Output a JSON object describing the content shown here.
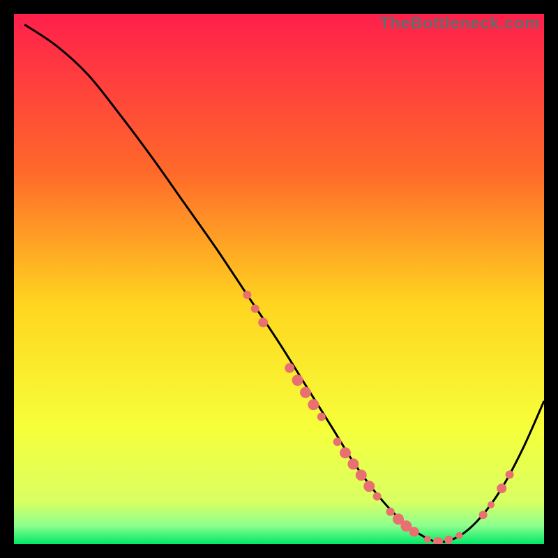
{
  "watermark": "TheBottleneck.com",
  "chart_data": {
    "type": "line",
    "title": "",
    "xlabel": "",
    "ylabel": "",
    "xlim": [
      0,
      100
    ],
    "ylim": [
      0,
      100
    ],
    "grid": false,
    "legend": false,
    "gradient_stops": [
      {
        "offset": 0,
        "color": "#ff1f4b"
      },
      {
        "offset": 0.3,
        "color": "#ff6a2a"
      },
      {
        "offset": 0.55,
        "color": "#ffd61f"
      },
      {
        "offset": 0.78,
        "color": "#f6ff3a"
      },
      {
        "offset": 0.92,
        "color": "#d9ff63"
      },
      {
        "offset": 0.965,
        "color": "#8dff8d"
      },
      {
        "offset": 1.0,
        "color": "#00e868"
      }
    ],
    "series": [
      {
        "name": "bottleneck-curve",
        "color": "#000000",
        "x": [
          2,
          8,
          14,
          20,
          26,
          32,
          38,
          44,
          50,
          55,
          60,
          64,
          68,
          72,
          76,
          80,
          84,
          88,
          92,
          96,
          100
        ],
        "y": [
          98,
          94,
          88.5,
          81,
          73,
          64.5,
          56,
          47,
          38,
          30,
          22,
          15.5,
          10,
          5.5,
          2.2,
          0.4,
          1.5,
          5,
          10.5,
          18,
          27
        ]
      }
    ],
    "markers": {
      "name": "highlight-points",
      "color": "#e87070",
      "points": [
        {
          "x": 44,
          "y": 47,
          "r": 6
        },
        {
          "x": 45.5,
          "y": 44.4,
          "r": 6
        },
        {
          "x": 47,
          "y": 41.8,
          "r": 7
        },
        {
          "x": 52,
          "y": 33.2,
          "r": 7
        },
        {
          "x": 53.5,
          "y": 30.9,
          "r": 8
        },
        {
          "x": 55,
          "y": 28.6,
          "r": 8
        },
        {
          "x": 56.5,
          "y": 26.3,
          "r": 8
        },
        {
          "x": 58,
          "y": 24,
          "r": 6
        },
        {
          "x": 61,
          "y": 19.3,
          "r": 6
        },
        {
          "x": 62.5,
          "y": 17.2,
          "r": 8
        },
        {
          "x": 64,
          "y": 15.1,
          "r": 8
        },
        {
          "x": 65.5,
          "y": 13,
          "r": 8
        },
        {
          "x": 67,
          "y": 10.9,
          "r": 8
        },
        {
          "x": 68.5,
          "y": 9,
          "r": 6
        },
        {
          "x": 71,
          "y": 6.1,
          "r": 6
        },
        {
          "x": 72.5,
          "y": 4.7,
          "r": 8
        },
        {
          "x": 74,
          "y": 3.4,
          "r": 8
        },
        {
          "x": 75.5,
          "y": 2.3,
          "r": 7
        },
        {
          "x": 78,
          "y": 0.9,
          "r": 5
        },
        {
          "x": 80,
          "y": 0.4,
          "r": 7
        },
        {
          "x": 82,
          "y": 0.8,
          "r": 6
        },
        {
          "x": 84,
          "y": 1.6,
          "r": 5
        },
        {
          "x": 88.5,
          "y": 5.5,
          "r": 6
        },
        {
          "x": 90,
          "y": 7.4,
          "r": 5
        },
        {
          "x": 92,
          "y": 10.5,
          "r": 7
        },
        {
          "x": 93.5,
          "y": 13.1,
          "r": 6
        }
      ]
    }
  }
}
